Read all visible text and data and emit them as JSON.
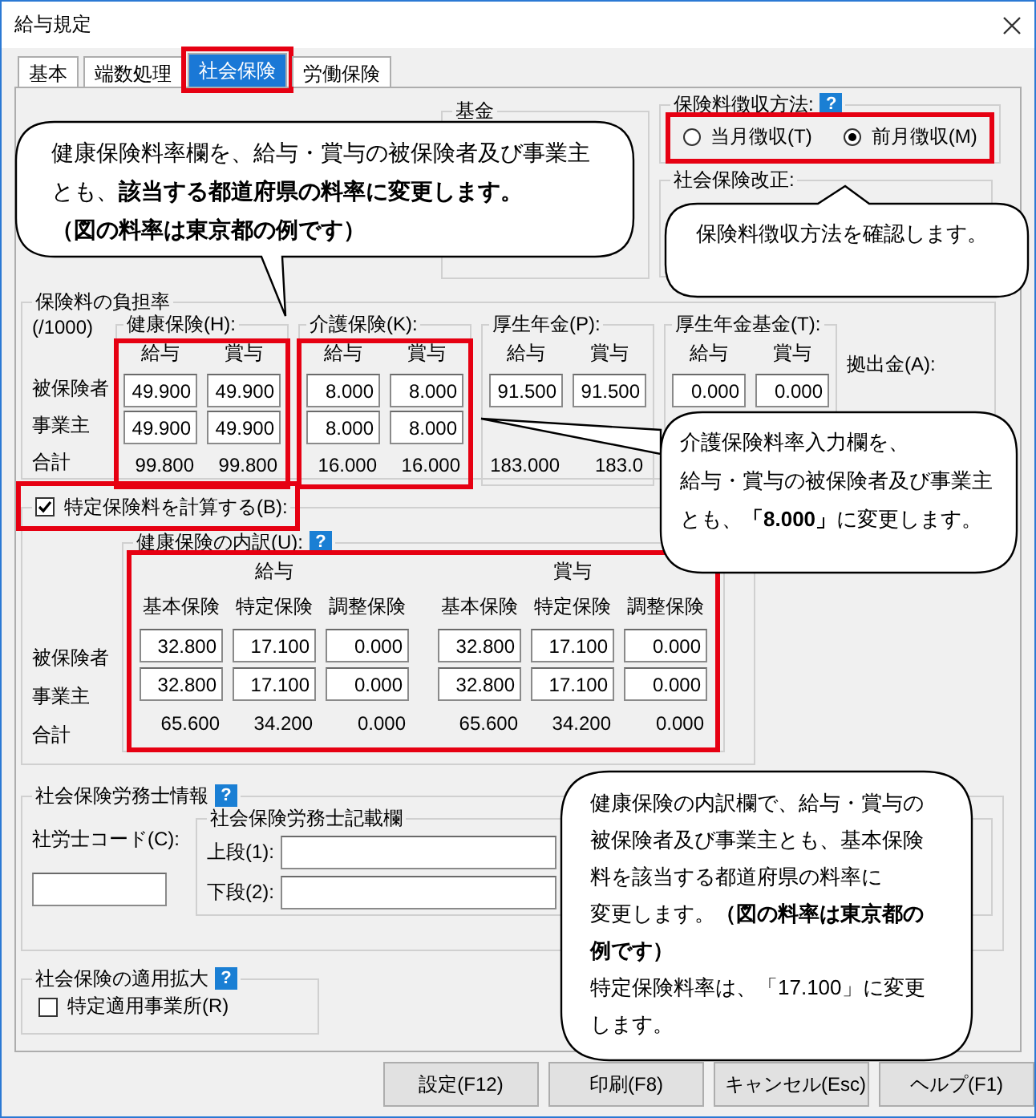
{
  "window": {
    "title": "給与規定"
  },
  "tabs": [
    {
      "label": "基本",
      "selected": false
    },
    {
      "label": "端数処理",
      "selected": false
    },
    {
      "label": "社会保険",
      "selected": true
    },
    {
      "label": "労働保険",
      "selected": false
    }
  ],
  "fund": {
    "label": "基金"
  },
  "collection_method": {
    "label": "保険料徴収方法:",
    "help": "?",
    "options": [
      {
        "label": "当月徴収(T)",
        "selected": false
      },
      {
        "label": "前月徴収(M)",
        "selected": true
      }
    ]
  },
  "revision": {
    "label": "社会保険改正:"
  },
  "rates": {
    "label": "保険料の負担率",
    "unit": "(/1000)",
    "row_labels": [
      "被保険者",
      "事業主",
      "合計"
    ],
    "groups": [
      {
        "label": "健康保険(H):",
        "columns": [
          "給与",
          "賞与"
        ],
        "rows": [
          [
            "49.900",
            "49.900"
          ],
          [
            "49.900",
            "49.900"
          ]
        ],
        "totals": [
          "99.800",
          "99.800"
        ]
      },
      {
        "label": "介護保険(K):",
        "columns": [
          "給与",
          "賞与"
        ],
        "rows": [
          [
            "8.000",
            "8.000"
          ],
          [
            "8.000",
            "8.000"
          ]
        ],
        "totals": [
          "16.000",
          "16.000"
        ]
      },
      {
        "label": "厚生年金(P):",
        "columns": [
          "給与",
          "賞与"
        ],
        "rows": [
          [
            "91.500",
            "91.500"
          ]
        ],
        "totals": [
          "183.000",
          "183.0"
        ]
      },
      {
        "label": "厚生年金基金(T):",
        "columns": [
          "給与",
          "賞与"
        ],
        "rows": [
          [
            "0.000",
            "0.000"
          ]
        ]
      }
    ],
    "contribution": {
      "label": "拠出金(A):"
    }
  },
  "specific": {
    "label": "特定保険料を計算する(B):",
    "checked": true,
    "row_labels": [
      "被保険者",
      "事業主",
      "合計"
    ],
    "breakdown": {
      "label": "健康保険の内訳(U):",
      "help": "?",
      "halves": [
        {
          "label": "給与",
          "columns": [
            "基本保険",
            "特定保険",
            "調整保険"
          ],
          "rows": [
            [
              "32.800",
              "17.100",
              "0.000"
            ],
            [
              "32.800",
              "17.100",
              "0.000"
            ]
          ],
          "totals": [
            "65.600",
            "34.200",
            "0.000"
          ]
        },
        {
          "label": "賞与",
          "columns": [
            "基本保険",
            "特定保険",
            "調整保険"
          ],
          "rows": [
            [
              "32.800",
              "17.100",
              "0.000"
            ],
            [
              "32.800",
              "17.100",
              "0.000"
            ]
          ],
          "totals": [
            "65.600",
            "34.200",
            "0.000"
          ]
        }
      ]
    }
  },
  "sharoushi": {
    "label": "社会保険労務士情報",
    "help": "?",
    "code_label": "社労士コード(C):",
    "entry": {
      "label": "社会保険労務士記載欄",
      "fields": [
        {
          "label": "上段(1):"
        },
        {
          "label": "下段(2):"
        }
      ]
    }
  },
  "expansion": {
    "label": "社会保険の適用拡大",
    "help": "?",
    "checkbox": {
      "label": "特定適用事業所(R)",
      "checked": false
    }
  },
  "buttons": [
    "設定(F12)",
    "印刷(F8)",
    "キャンセル(Esc)",
    "ヘルプ(F1)"
  ],
  "callouts": [
    {
      "paragraphs": [
        {
          "text": "健康保険料率欄を、給与・賞与の被保険者及び事業主とも、**該当する都道府県の料率に変更します。**",
          "bold": false
        },
        {
          "text": "（図の料率は東京都の例です）",
          "bold": true
        }
      ]
    },
    {
      "paragraphs": [
        {
          "text": "保険料徴収方法を確認します。",
          "bold": false
        }
      ]
    },
    {
      "paragraphs": [
        {
          "text": "介護保険料率入力欄を、",
          "bold": false
        },
        {
          "text": "給与・賞与の被保険者及び事業主とも、**「8.000」**に変更します。",
          "bold": false
        }
      ]
    },
    {
      "paragraphs": [
        {
          "text": "健康保険の内訳欄で、給与・賞与の被保険者及び事業主とも、基本保険料を該当する都道府県の料率に",
          "bold": false
        },
        {
          "text": "変更します。**（図の料率は東京都の例です）**",
          "bold": false
        },
        {
          "text": "特定保険料率は、「17.100」に変更します。",
          "bold": false
        }
      ]
    }
  ]
}
